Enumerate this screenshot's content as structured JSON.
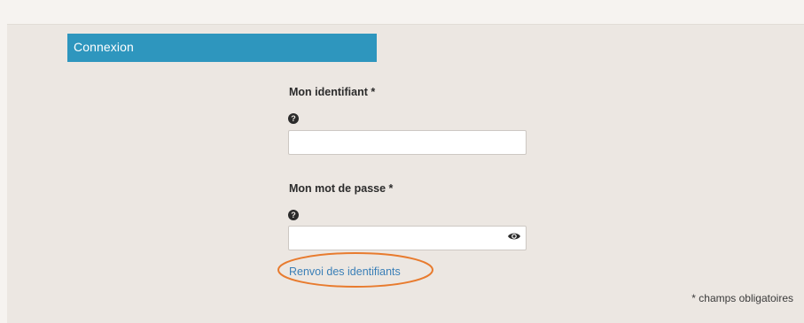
{
  "header": {
    "tab_label": "Connexion"
  },
  "form": {
    "identifier": {
      "label": "Mon identifiant *",
      "help_icon": "question-circle-icon",
      "value": ""
    },
    "password": {
      "label": "Mon mot de passe *",
      "help_icon": "question-circle-icon",
      "value": "",
      "toggle_icon": "eye-icon"
    },
    "forgot_link": "Renvoi des identifiants",
    "required_note": "* champs obligatoires"
  },
  "colors": {
    "tab_background": "#2e96be",
    "link": "#3a7fb7",
    "highlight_annotation": "#e87b2e",
    "panel_background": "#ece7e2"
  }
}
